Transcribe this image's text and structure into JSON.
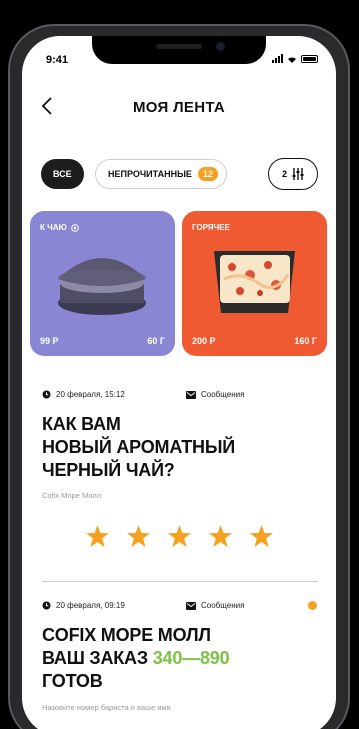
{
  "status": {
    "time": "9:41"
  },
  "header": {
    "title": "МОЯ ЛЕНТА"
  },
  "filters": {
    "all_label": "ВСЕ",
    "unread_label": "НЕПРОЧИТАННЫЕ",
    "unread_count": "12",
    "filter_count": "2"
  },
  "cards": [
    {
      "category": "К ЧАЮ",
      "price": "99 Р",
      "weight": "60 Г",
      "color": "#8a86d3"
    },
    {
      "category": "ГОРЯЧЕЕ",
      "price": "200 Р",
      "weight": "160 Г",
      "color": "#ef5a33"
    }
  ],
  "posts": [
    {
      "date": "20 февраля, 15:12",
      "type": "Сообщения",
      "title_lines": [
        "КАК ВАМ",
        "НОВЫЙ АРОМАТНЫЙ",
        "ЧЕРНЫЙ ЧАЙ?"
      ],
      "source": "Cofix Mope Молл",
      "rating_stars": 5
    },
    {
      "date": "20 февраля, 09:19",
      "type": "Сообщения",
      "title_line1": "COFIX МОРЕ МОЛЛ",
      "title_line2_prefix": "ВАШ ЗАКАЗ ",
      "order_number": "340—890",
      "title_line3": "ГОТОВ",
      "subtitle": "Назовите номер бариста и ваше имя",
      "unread": true
    }
  ],
  "colors": {
    "accent_orange": "#f6a020",
    "star": "#f6a020",
    "order_green": "#7dc246"
  }
}
